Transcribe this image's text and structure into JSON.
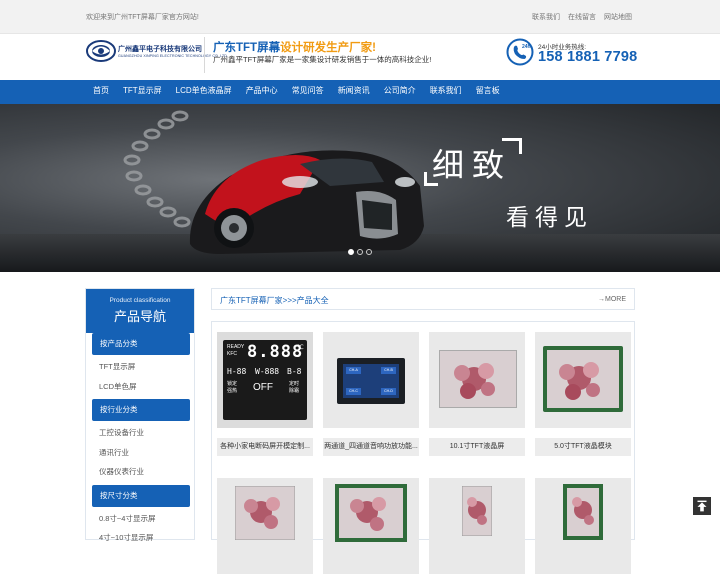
{
  "topbar": {
    "welcome": "欢迎来到广州TFT屏幕厂家官方网站!",
    "links": [
      "联系我们",
      "在线留言",
      "网站地图"
    ]
  },
  "header": {
    "company_cn": "广州鑫平电子科技有限公司",
    "company_en": "GUANGZHOU XINPING ELECTRONIC TECHNOLOGY CO.,LTD",
    "slogan_main": "广东TFT屏幕",
    "slogan_highlight": "设计研发生产厂家!",
    "subslogan": "广州鑫平TFT屏幕厂家是一家集设计研发销售于一体的高科技企业!",
    "hotline_label": "24小时业务热线:",
    "hotline_number": "158 1881 7798",
    "phone_badge": "24h"
  },
  "nav": {
    "items": [
      "首页",
      "TFT显示屏",
      "LCD单色液晶屏",
      "产品中心",
      "常见问答",
      "新闻资讯",
      "公司简介",
      "联系我们",
      "留言板"
    ]
  },
  "banner": {
    "line1": "细致",
    "line2": "看得见",
    "slides": 3,
    "active_slide": 1
  },
  "sidebar": {
    "title_en": "Product classification",
    "title_cn": "产品导航",
    "cat_product": "按产品分类",
    "items_product": [
      "TFT显示屏",
      "LCD单色屏"
    ],
    "cat_industry": "按行业分类",
    "items_industry": [
      "工控设备行业",
      "通讯行业",
      "仪器仪表行业"
    ],
    "cat_size": "按尺寸分类",
    "items_size": [
      "0.8寸~4寸显示屏",
      "4寸~10寸显示屏"
    ]
  },
  "main": {
    "breadcrumb": "广东TFT屏幕厂家>>>产品大全",
    "more": "MORE",
    "products": [
      {
        "caption": "各种小家电断码屏开模定制..."
      },
      {
        "caption": "两通道_四通道音响功放功能..."
      },
      {
        "caption": "10.1寸TFT液晶屏"
      },
      {
        "caption": "5.0寸TFT液晶模块"
      }
    ],
    "lcd_segment": {
      "ready": "READY",
      "kfc": "KFC",
      "digits": "8.888",
      "unit": "℃",
      "row_a": "H-88",
      "row_b": "W-888",
      "row_c": "B-8",
      "lab1": "锁定",
      "lab2": "强热",
      "off": "OFF",
      "lab3": "定时",
      "lab4": "除霜"
    },
    "pcb_labels": [
      "CH-A",
      "CH-B",
      "CH-C",
      "CH-D"
    ]
  },
  "colors": {
    "brand_blue": "#1561b5",
    "accent_orange": "#f19b12"
  }
}
